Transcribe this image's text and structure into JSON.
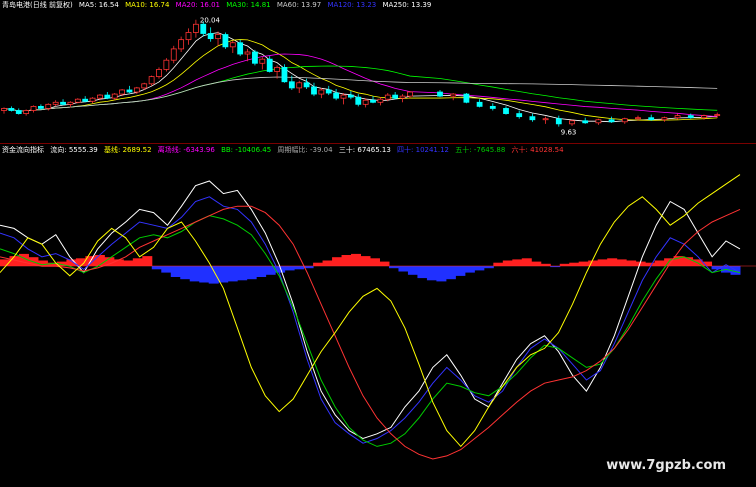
{
  "upper_legend": {
    "title": "青岛电港(日线 前复权)",
    "items": [
      {
        "text": "MA5: 16.54",
        "color": "#ffffff"
      },
      {
        "text": "MA10: 16.74",
        "color": "#ffff00"
      },
      {
        "text": "MA20: 16.01",
        "color": "#ff00ff"
      },
      {
        "text": "MA30: 14.81",
        "color": "#00ff00"
      },
      {
        "text": "MA60: 13.97",
        "color": "#cccccc"
      },
      {
        "text": "MA120: 13.23",
        "color": "#3333ff"
      },
      {
        "text": "MA250: 13.39",
        "color": "#ffffff"
      }
    ]
  },
  "lower_legend": {
    "title": "资金流向指标",
    "items": [
      {
        "text": "流向: 5555.39",
        "color": "#ffffff"
      },
      {
        "text": "基线: 2689.52",
        "color": "#ffff00"
      },
      {
        "text": "离场线: -6343.96",
        "color": "#ff00ff"
      },
      {
        "text": "BB: -10406.45",
        "color": "#00ff00"
      },
      {
        "text": "周期幅比: -39.04",
        "color": "#aaaaaa"
      },
      {
        "text": "三十: 67465.13",
        "color": "#ffffff"
      },
      {
        "text": "四十: 10241.12",
        "color": "#3333ff"
      },
      {
        "text": "五十: -7645.88",
        "color": "#00cc00"
      },
      {
        "text": "六十: 41028.54",
        "color": "#ff3333"
      }
    ]
  },
  "annotations": {
    "high_label": "20.04",
    "low_label": "9.63"
  },
  "watermark": "www.7gpzb.com",
  "chart_data": [
    {
      "type": "candlestick",
      "title": "青岛电港(日线 前复权)",
      "annotations": [
        "20.04",
        "9.63"
      ],
      "ohlc": [
        [
          11.2,
          11.5,
          10.9,
          11.4
        ],
        [
          11.4,
          11.6,
          11.1,
          11.2
        ],
        [
          11.2,
          11.4,
          10.8,
          10.9
        ],
        [
          10.9,
          11.3,
          10.7,
          11.2
        ],
        [
          11.2,
          11.7,
          11.0,
          11.6
        ],
        [
          11.6,
          11.8,
          11.3,
          11.4
        ],
        [
          11.4,
          11.9,
          11.2,
          11.8
        ],
        [
          11.8,
          12.2,
          11.6,
          12.0
        ],
        [
          12.0,
          12.3,
          11.7,
          11.8
        ],
        [
          11.8,
          12.1,
          11.5,
          12.0
        ],
        [
          12.0,
          12.4,
          11.9,
          12.3
        ],
        [
          12.3,
          12.6,
          12.0,
          12.1
        ],
        [
          12.1,
          12.5,
          11.9,
          12.4
        ],
        [
          12.4,
          12.8,
          12.2,
          12.7
        ],
        [
          12.7,
          13.0,
          12.3,
          12.4
        ],
        [
          12.4,
          12.9,
          12.2,
          12.8
        ],
        [
          12.8,
          13.3,
          12.6,
          13.2
        ],
        [
          13.2,
          13.6,
          12.9,
          13.0
        ],
        [
          13.0,
          13.5,
          12.8,
          13.4
        ],
        [
          13.4,
          13.9,
          13.2,
          13.8
        ],
        [
          13.8,
          14.6,
          13.6,
          14.5
        ],
        [
          14.5,
          15.4,
          14.3,
          15.2
        ],
        [
          15.2,
          16.3,
          15.0,
          16.1
        ],
        [
          16.1,
          17.5,
          15.8,
          17.2
        ],
        [
          17.2,
          18.4,
          16.9,
          18.1
        ],
        [
          18.1,
          19.2,
          17.6,
          18.8
        ],
        [
          18.8,
          20.04,
          18.3,
          19.6
        ],
        [
          19.6,
          19.9,
          18.4,
          18.7
        ],
        [
          18.7,
          19.3,
          17.9,
          18.2
        ],
        [
          18.2,
          18.9,
          17.5,
          18.6
        ],
        [
          18.6,
          18.8,
          17.2,
          17.4
        ],
        [
          17.4,
          18.0,
          16.8,
          17.8
        ],
        [
          17.8,
          18.1,
          16.5,
          16.7
        ],
        [
          16.7,
          17.2,
          16.0,
          16.9
        ],
        [
          16.9,
          17.1,
          15.6,
          15.8
        ],
        [
          15.8,
          16.4,
          15.2,
          16.2
        ],
        [
          16.2,
          16.5,
          14.9,
          15.0
        ],
        [
          15.0,
          15.6,
          14.3,
          15.4
        ],
        [
          15.4,
          15.7,
          13.9,
          14.0
        ],
        [
          14.0,
          14.6,
          13.2,
          13.4
        ],
        [
          13.4,
          14.1,
          12.9,
          13.9
        ],
        [
          13.9,
          14.3,
          13.3,
          13.5
        ],
        [
          13.5,
          13.9,
          12.6,
          12.8
        ],
        [
          12.8,
          13.4,
          12.4,
          13.2
        ],
        [
          13.2,
          13.6,
          12.7,
          12.9
        ],
        [
          12.9,
          13.3,
          12.2,
          12.4
        ],
        [
          12.4,
          12.9,
          11.8,
          12.7
        ],
        [
          12.7,
          13.1,
          12.3,
          12.5
        ],
        [
          12.5,
          12.8,
          11.6,
          11.8
        ],
        [
          11.8,
          12.4,
          11.5,
          12.2
        ],
        [
          12.2,
          12.6,
          11.9,
          12.0
        ],
        [
          12.0,
          12.5,
          11.7,
          12.3
        ],
        [
          12.3,
          12.9,
          12.1,
          12.7
        ],
        [
          12.7,
          13.0,
          12.3,
          12.4
        ],
        [
          12.4,
          12.8,
          12.0,
          12.6
        ],
        [
          12.6,
          13.1,
          12.4,
          13.0
        ],
        [
          13.0,
          13.2,
          12.5,
          12.6
        ],
        [
          12.6,
          12.9,
          12.2,
          12.8
        ],
        [
          12.8,
          12.9,
          11.9,
          12.0
        ],
        [
          12.0,
          12.3,
          11.5,
          11.6
        ],
        [
          11.6,
          11.9,
          11.2,
          11.4
        ],
        [
          11.4,
          11.6,
          10.8,
          10.9
        ],
        [
          10.9,
          11.2,
          10.4,
          10.6
        ],
        [
          10.6,
          10.9,
          10.1,
          10.3
        ],
        [
          10.3,
          10.6,
          9.9,
          10.4
        ],
        [
          10.4,
          10.7,
          9.63,
          9.9
        ],
        [
          9.9,
          10.3,
          9.7,
          10.2
        ],
        [
          10.2,
          10.5,
          9.9,
          10.0
        ],
        [
          10.0,
          10.4,
          9.8,
          10.3
        ],
        [
          10.3,
          10.6,
          10.0,
          10.1
        ],
        [
          10.1,
          10.5,
          9.9,
          10.4
        ],
        [
          10.4,
          10.7,
          10.2,
          10.5
        ],
        [
          10.5,
          10.8,
          10.2,
          10.3
        ],
        [
          10.3,
          10.6,
          10.1,
          10.5
        ],
        [
          10.5,
          10.9,
          10.3,
          10.7
        ],
        [
          10.7,
          10.9,
          10.4,
          10.5
        ],
        [
          10.5,
          10.8,
          10.3,
          10.7
        ],
        [
          10.7,
          11.0,
          10.5,
          10.8
        ]
      ]
    },
    {
      "type": "line",
      "title": "资金流向指标",
      "ylim": [
        -100,
        100
      ],
      "series": [
        {
          "name": "三十",
          "color": "#ffffff",
          "values": [
            60,
            58,
            52,
            48,
            54,
            40,
            30,
            45,
            55,
            62,
            70,
            68,
            60,
            72,
            85,
            88,
            80,
            82,
            70,
            55,
            35,
            10,
            -20,
            -45,
            -60,
            -70,
            -75,
            -72,
            -68,
            -55,
            -45,
            -30,
            -22,
            -35,
            -50,
            -55,
            -40,
            -25,
            -15,
            -10,
            -20,
            -35,
            -45,
            -30,
            -10,
            15,
            40,
            60,
            75,
            70,
            55,
            40,
            50,
            45
          ]
        },
        {
          "name": "四十",
          "color": "#3333ff",
          "values": [
            55,
            52,
            45,
            40,
            42,
            38,
            32,
            40,
            48,
            55,
            62,
            60,
            58,
            65,
            75,
            78,
            72,
            70,
            62,
            48,
            30,
            5,
            -25,
            -50,
            -65,
            -72,
            -78,
            -75,
            -70,
            -62,
            -52,
            -40,
            -30,
            -38,
            -48,
            -52,
            -45,
            -30,
            -18,
            -12,
            -18,
            -28,
            -38,
            -32,
            -15,
            5,
            25,
            40,
            52,
            48,
            40,
            30,
            35,
            30
          ]
        },
        {
          "name": "五十",
          "color": "#00cc00",
          "values": [
            45,
            42,
            38,
            35,
            36,
            34,
            30,
            34,
            40,
            46,
            52,
            54,
            52,
            56,
            62,
            66,
            64,
            60,
            54,
            42,
            28,
            8,
            -15,
            -38,
            -55,
            -68,
            -76,
            -80,
            -78,
            -72,
            -62,
            -50,
            -40,
            -42,
            -46,
            -48,
            -42,
            -34,
            -24,
            -16,
            -18,
            -24,
            -30,
            -28,
            -18,
            -4,
            12,
            26,
            38,
            40,
            36,
            30,
            32,
            30
          ]
        },
        {
          "name": "六十",
          "color": "#ff3333",
          "values": [
            40,
            38,
            36,
            34,
            34,
            33,
            31,
            33,
            36,
            40,
            46,
            50,
            54,
            58,
            62,
            66,
            70,
            72,
            72,
            68,
            60,
            48,
            30,
            10,
            -10,
            -30,
            -48,
            -62,
            -72,
            -80,
            -85,
            -88,
            -86,
            -82,
            -75,
            -68,
            -60,
            -52,
            -45,
            -40,
            -38,
            -36,
            -32,
            -26,
            -18,
            -6,
            8,
            22,
            36,
            48,
            56,
            62,
            66,
            70
          ]
        },
        {
          "name": "流向",
          "color": "#ffff00",
          "values": [
            30,
            40,
            52,
            48,
            36,
            28,
            36,
            50,
            58,
            52,
            40,
            46,
            58,
            62,
            50,
            36,
            20,
            -5,
            -30,
            -48,
            -58,
            -50,
            -35,
            -20,
            -8,
            5,
            15,
            20,
            12,
            -5,
            -28,
            -52,
            -70,
            -80,
            -70,
            -55,
            -42,
            -30,
            -22,
            -18,
            -8,
            10,
            30,
            48,
            62,
            72,
            78,
            70,
            60,
            66,
            74,
            80,
            86,
            92
          ]
        }
      ]
    },
    {
      "type": "bar",
      "title": "资金流向指标",
      "name": "流向柱",
      "ylim": [
        -20,
        20
      ],
      "values": [
        6,
        9,
        11,
        8,
        5,
        3,
        4,
        6,
        7,
        9,
        10,
        8,
        6,
        5,
        7,
        9,
        -3,
        -6,
        -10,
        -12,
        -14,
        -15,
        -16,
        -15,
        -14,
        -13,
        -12,
        -10,
        -8,
        -6,
        -4,
        -3,
        -2,
        3,
        5,
        8,
        10,
        11,
        9,
        7,
        4,
        -2,
        -5,
        -8,
        -11,
        -13,
        -14,
        -12,
        -9,
        -6,
        -4,
        -2,
        3,
        5,
        6,
        7,
        4,
        2,
        -1,
        2,
        3,
        4,
        5,
        6,
        7,
        6,
        5,
        4,
        3,
        5,
        7,
        9,
        8,
        6,
        4,
        -3,
        -6,
        -8
      ]
    }
  ]
}
